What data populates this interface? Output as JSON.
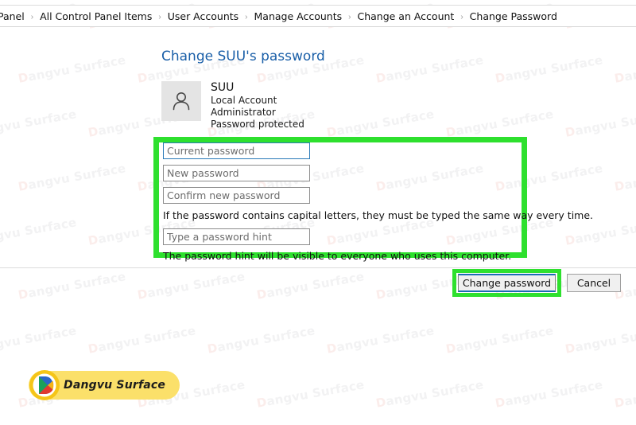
{
  "breadcrumb": {
    "separator": "›",
    "items": [
      {
        "label": "Panel"
      },
      {
        "label": "All Control Panel Items"
      },
      {
        "label": "User Accounts"
      },
      {
        "label": "Manage Accounts"
      },
      {
        "label": "Change an Account"
      },
      {
        "label": "Change Password"
      }
    ]
  },
  "main": {
    "title": "Change SUU's password",
    "account": {
      "name": "SUU",
      "type": "Local Account",
      "role": "Administrator",
      "protection": "Password protected",
      "avatar_icon": "person-icon"
    },
    "form": {
      "current_password": {
        "placeholder": "Current password",
        "value": ""
      },
      "new_password": {
        "placeholder": "New password",
        "value": ""
      },
      "confirm_password": {
        "placeholder": "Confirm new password",
        "value": ""
      },
      "capital_letters_note": "If the password contains capital letters, they must be typed the same way every time.",
      "password_hint": {
        "placeholder": "Type a password hint",
        "value": ""
      },
      "hint_note": "The password hint will be visible to everyone who uses this computer."
    },
    "buttons": {
      "submit_label": "Change password",
      "cancel_label": "Cancel"
    }
  },
  "brand": {
    "name": "Dangvu Surface",
    "logo_icon": "dangvu-logo-icon",
    "badge_color": "#fbe06a"
  },
  "watermark": {
    "text": "angvu Surface",
    "mark": "D"
  },
  "colors": {
    "title_blue": "#1a5fa8",
    "highlight_green": "#2ee02e",
    "focus_blue": "#2a7ab9",
    "button_face": "#f0f0f0"
  }
}
